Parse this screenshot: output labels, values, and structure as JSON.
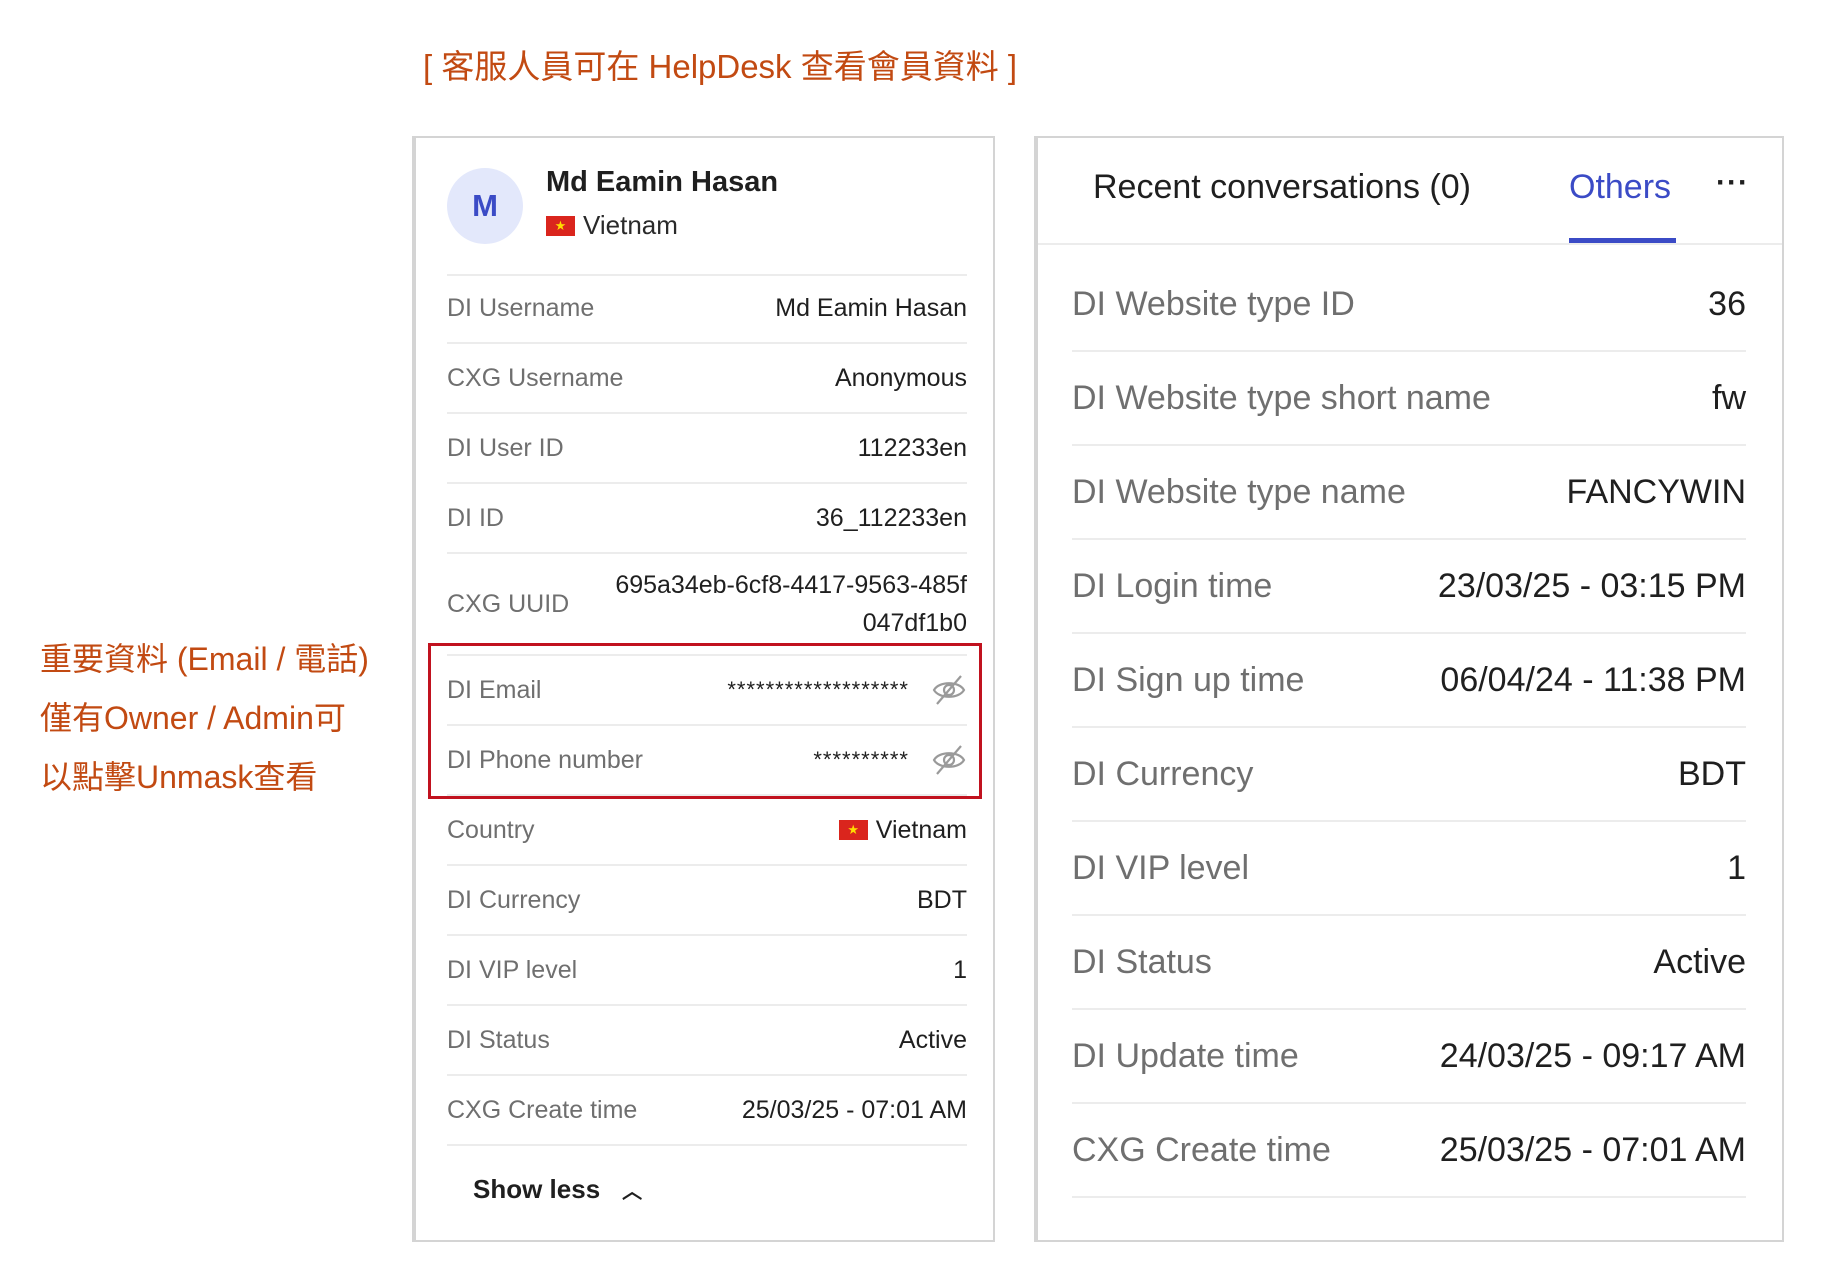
{
  "annotation": {
    "title": "[ 客服人員可在 HelpDesk 查看會員資料 ]",
    "note_lines": [
      "重要資料 (Email / 電話)",
      "僅有Owner / Admin可",
      "以點擊Unmask查看"
    ],
    "color": "#c24a12",
    "highlight_color": "#c1121f"
  },
  "profile": {
    "avatar_letter": "M",
    "name": "Md Eamin Hasan",
    "country": "Vietnam",
    "flag_icon": "vietnam-flag-icon"
  },
  "left_rows": [
    {
      "label": "DI Username",
      "value": "Md Eamin Hasan"
    },
    {
      "label": "CXG Username",
      "value": "Anonymous"
    },
    {
      "label": "DI User ID",
      "value": "112233en"
    },
    {
      "label": "DI ID",
      "value": "36_112233en"
    },
    {
      "label": "CXG UUID",
      "value": "695a34eb-6cf8-4417-9563-485f047df1b0"
    },
    {
      "label": "DI Email",
      "value": "*******************",
      "icon": "eye-off-icon"
    },
    {
      "label": "DI Phone number",
      "value": "**********",
      "icon": "eye-off-icon"
    },
    {
      "label": "Country",
      "value": "Vietnam"
    },
    {
      "label": "DI Currency",
      "value": "BDT"
    },
    {
      "label": "DI VIP level",
      "value": "1"
    },
    {
      "label": "DI Status",
      "value": "Active"
    },
    {
      "label": "CXG Create time",
      "value": "25/03/25 - 07:01 AM"
    }
  ],
  "show_less_label": "Show less",
  "tabs": {
    "recent": "Recent conversations (0)",
    "others": "Others",
    "more_icon": "more-horizontal-icon",
    "accent": "#3b4bc6"
  },
  "right_rows": [
    {
      "label": "DI Website type ID",
      "value": "36"
    },
    {
      "label": "DI Website type short name",
      "value": "fw"
    },
    {
      "label": "DI Website type name",
      "value": "FANCYWIN"
    },
    {
      "label": "DI Login time",
      "value": "23/03/25 - 03:15 PM"
    },
    {
      "label": "DI Sign up time",
      "value": "06/04/24 - 11:38 PM"
    },
    {
      "label": "DI Currency",
      "value": "BDT"
    },
    {
      "label": "DI VIP level",
      "value": "1"
    },
    {
      "label": "DI Status",
      "value": "Active"
    },
    {
      "label": "DI Update time",
      "value": "24/03/25 - 09:17 AM"
    },
    {
      "label": "CXG Create time",
      "value": "25/03/25 - 07:01 AM"
    }
  ]
}
